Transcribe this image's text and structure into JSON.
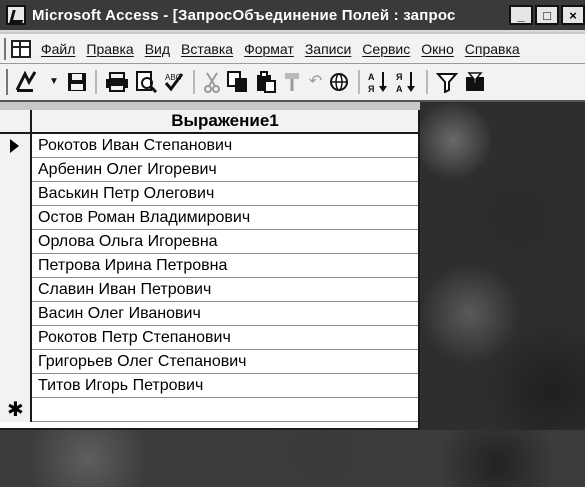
{
  "window": {
    "title": "Microsoft Access - [ЗапросОбъединение Полей : запрос",
    "controls": [
      "_",
      "□",
      "×"
    ]
  },
  "menu": {
    "items": [
      "Файл",
      "Правка",
      "Вид",
      "Вставка",
      "Формат",
      "Записи",
      "Сервис",
      "Окно",
      "Справка"
    ]
  },
  "toolbar": {
    "icons": [
      "design-view-icon",
      "save-icon",
      "print-icon",
      "print-preview-icon",
      "spelling-icon",
      "cut-icon",
      "copy-icon",
      "paste-icon",
      "format-painter-icon",
      "undo-icon",
      "hyperlink-icon",
      "sort-ascending-icon",
      "sort-descending-icon",
      "filter-by-selection-icon",
      "filter-by-form-icon"
    ]
  },
  "datasheet": {
    "column_header": "Выражение1",
    "rows": [
      "Рокотов Иван Степанович",
      "Арбенин Олег Игоревич",
      "Васькин Петр Олегович",
      "Остов Роман Владимирович",
      "Орлова Ольга Игоревна",
      "Петрова Ирина Петровна",
      "Славин Иван Петрович",
      "Васин Олег Иванович",
      "Рокотов Петр Степанович",
      "Григорьев Олег Степанович",
      "Титов Игорь Петрович"
    ],
    "current_row_marker": "▶",
    "new_row_marker": "✱"
  }
}
